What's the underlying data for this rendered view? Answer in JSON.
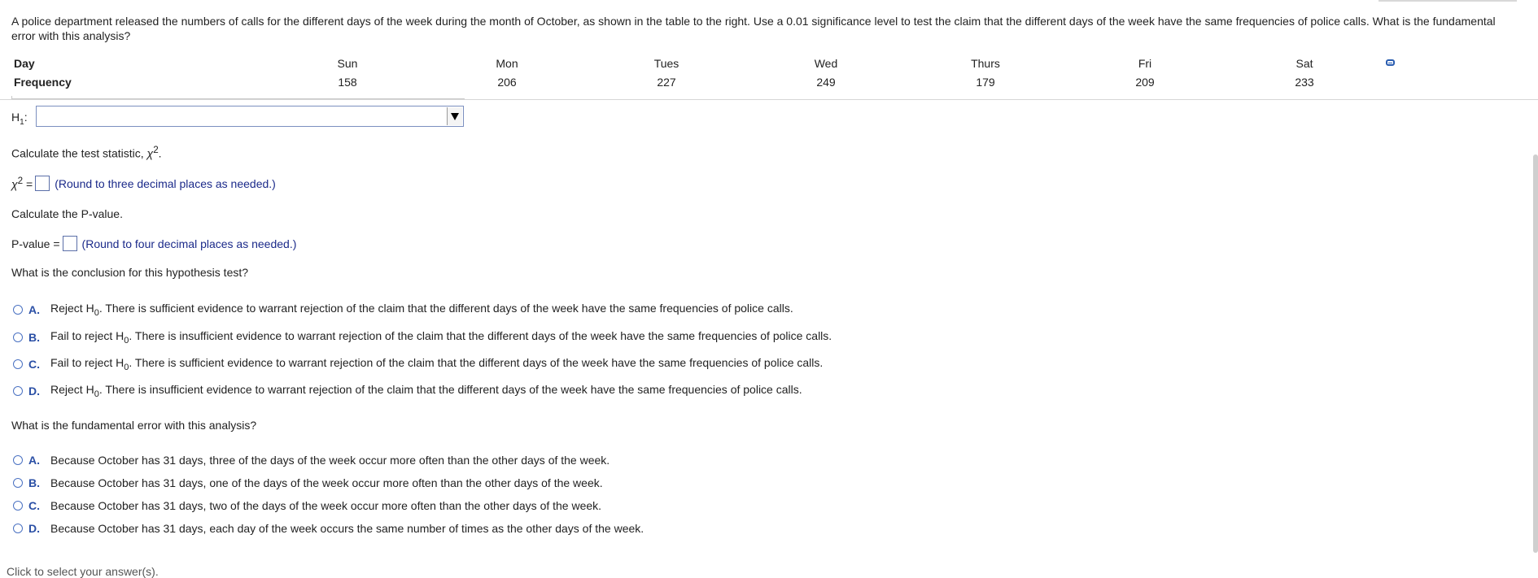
{
  "problem": {
    "text": "A police department released the numbers of calls for the different days of the week during the month of October, as shown in the table to the right. Use a 0.01 significance level to test the claim that the different days of the week have the same frequencies of police calls. What is the fundamental error with this analysis?"
  },
  "table": {
    "row1_label": "Day",
    "row2_label": "Frequency",
    "days": [
      "Sun",
      "Mon",
      "Tues",
      "Wed",
      "Thurs",
      "Fri",
      "Sat"
    ],
    "frequencies": [
      "158",
      "206",
      "227",
      "249",
      "179",
      "209",
      "233"
    ],
    "copy_icon": "copy-icon"
  },
  "h1": {
    "label": "H",
    "sub": "1",
    "colon": ":",
    "selected_value": ""
  },
  "test_statistic": {
    "prompt_prefix": "Calculate the test statistic, ",
    "chi_symbol": "χ",
    "sup": "2",
    "prompt_suffix": ".",
    "answer_prefix_eq": " =",
    "hint": "(Round to three decimal places as needed.)"
  },
  "p_value": {
    "prompt": "Calculate the P-value.",
    "answer_label": "P-value =",
    "hint": "(Round to four decimal places as needed.)"
  },
  "conclusion": {
    "question": "What is the conclusion for this hypothesis test?",
    "options": [
      {
        "letter": "A.",
        "pre": "Reject H",
        "sub": "0",
        "post": ". There is sufficient evidence to warrant rejection of the claim that the different days of the week have the same frequencies of police calls."
      },
      {
        "letter": "B.",
        "pre": "Fail to reject H",
        "sub": "0",
        "post": ". There is insufficient evidence to warrant rejection of the claim that the different days of the week have the same frequencies of police calls."
      },
      {
        "letter": "C.",
        "pre": "Fail to reject H",
        "sub": "0",
        "post": ". There is sufficient evidence to warrant rejection of the claim that the different days of the week have the same frequencies of police calls."
      },
      {
        "letter": "D.",
        "pre": "Reject H",
        "sub": "0",
        "post": ". There is insufficient evidence to warrant rejection of the claim that the different days of the week have the same frequencies of police calls."
      }
    ]
  },
  "error": {
    "question": "What is the fundamental error with this analysis?",
    "options": [
      {
        "letter": "A.",
        "text": "Because October has 31 days, three of the days of the week occur more often than the other days of the week."
      },
      {
        "letter": "B.",
        "text": "Because October has 31 days, one of the days of the week occur more often than the other days of the week."
      },
      {
        "letter": "C.",
        "text": "Because October has 31 days, two of the days of the week occur more often than the other days of the week."
      },
      {
        "letter": "D.",
        "text": "Because October has 31 days, each day of the week occurs the same number of times as the other days of the week."
      }
    ]
  },
  "footer": {
    "text": "Click to select your answer(s)."
  },
  "colors": {
    "accent": "#2a4fa5",
    "hint": "#1b2a8a",
    "radio": "#4b72c2"
  }
}
